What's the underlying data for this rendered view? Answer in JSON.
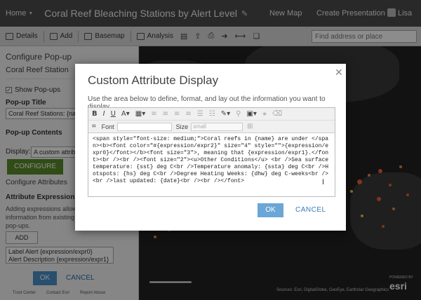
{
  "header": {
    "home": "Home",
    "map_title": "Coral Reef Bleaching Stations by Alert Level",
    "new_map": "New Map",
    "create_presentation": "Create Presentation",
    "user": "Lisa"
  },
  "toolbar": {
    "details": "Details",
    "add": "Add",
    "basemap": "Basemap",
    "analysis": "Analysis",
    "search_placeholder": "Find address or place"
  },
  "left_panel": {
    "title": "Configure Pop-up",
    "layer": "Coral Reef Station",
    "show_popups": "Show Pop-ups",
    "popup_title_label": "Pop-up Title",
    "popup_title_value": "Coral Reef Stations: {name}",
    "popup_contents_label": "Pop-up Contents",
    "display_label": "Display:",
    "display_value": "A custom attribute display",
    "configure_button": "CONFIGURE",
    "configure_attributes": "Configure Attributes",
    "attribute_expressions": "Attribute Expressions",
    "expressions_text": "Adding expressions allows you to add new information from existing attributes for use in pop-ups.",
    "add_button": "ADD",
    "expressions": [
      "Label Alert {expression/expr0}",
      "Alert Description {expression/expr1}"
    ],
    "ok": "OK",
    "cancel": "CANCEL",
    "footer": [
      "Trust Center",
      "Contact Esri",
      "Report Abuse"
    ]
  },
  "modal": {
    "title": "Custom Attribute Display",
    "description": "Use the area below to define, format, and lay out the information you want to display.",
    "font_label": "Font",
    "size_label": "Size",
    "size_value": "small",
    "source": "<span style=\"font-size: medium;\">Coral reefs in {name} are under </span><b><font color=\"#{expression/expr2}\" size=\"4\" style=\"\">{expression/expr0}</font></b><font size=\"3\">, meaning that {expression/expr1}.</font><br /><br /><font size=\"2\"><u>Other Conditions</u> <br />Sea surface temperature: {sst} deg C<br />Temperature anomaly: {ssta} deg C<br />Hotspots: {hs} deg C<br />Degree Heating Weeks: {dhw} deg C-weeks<br /><br />last updated: {date}<br /><br /></font>",
    "ok": "OK",
    "cancel": "CANCEL"
  },
  "map": {
    "attribution": "Sources: Esri, DigitalGlobe, GeoEye, Earthstar Geographics",
    "powered_by": "POWERED BY",
    "esri": "esri"
  }
}
